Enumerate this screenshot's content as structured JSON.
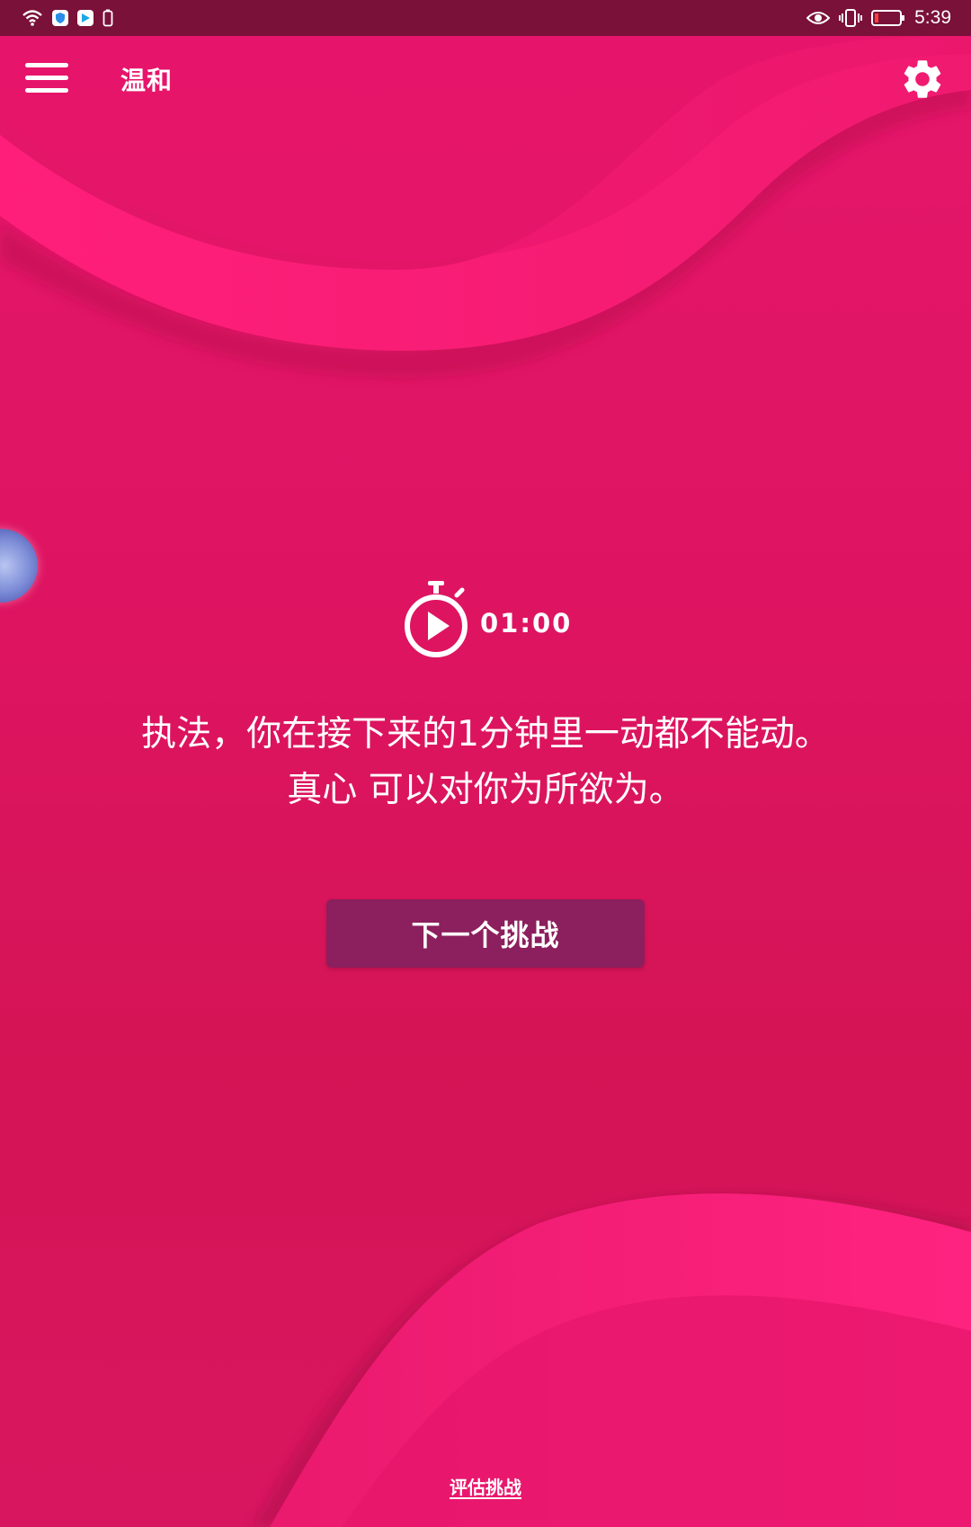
{
  "colors": {
    "background": "#dd1460",
    "status_bar": "#7a1138",
    "button": "#8c1f5d",
    "text": "#ffffff",
    "wave_highlight": "#ff1f7a"
  },
  "status_bar": {
    "time": "5:39",
    "left_icons": [
      "wifi-icon",
      "shield-app-icon",
      "play-app-icon",
      "phone-battery-small-icon"
    ],
    "right_icons": [
      "eye-icon",
      "vibrate-icon",
      "battery-low-icon"
    ]
  },
  "toolbar": {
    "title": "温和",
    "menu_icon": "hamburger-menu-icon",
    "settings_icon": "gear-icon"
  },
  "timer": {
    "time": "01:00",
    "icon": "stopwatch-play-icon"
  },
  "challenge": {
    "text": "执法，你在接下来的1分钟里一动都不能动。真心 可以对你为所欲为。"
  },
  "buttons": {
    "next_challenge": "下一个挑战"
  },
  "footer": {
    "evaluate_link": "评估挑战"
  }
}
